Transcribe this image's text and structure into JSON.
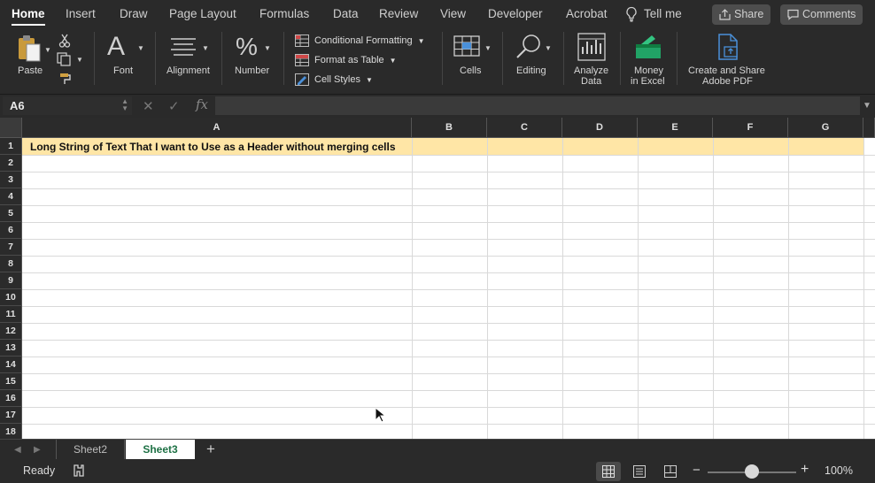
{
  "ribbon_tabs": [
    {
      "label": "Home",
      "active": true
    },
    {
      "label": "Insert",
      "active": false
    },
    {
      "label": "Draw",
      "active": false
    },
    {
      "label": "Page Layout",
      "active": false
    },
    {
      "label": "Formulas",
      "active": false
    },
    {
      "label": "Data",
      "active": false
    },
    {
      "label": "Review",
      "active": false
    },
    {
      "label": "View",
      "active": false
    },
    {
      "label": "Developer",
      "active": false
    },
    {
      "label": "Acrobat",
      "active": false
    }
  ],
  "tell_me": {
    "label": "Tell me",
    "icon": "lightbulb-icon"
  },
  "header_buttons": {
    "share": "Share",
    "comments": "Comments"
  },
  "ribbon": {
    "paste": "Paste",
    "font": "Font",
    "alignment": "Alignment",
    "number": "Number",
    "conditional_formatting": "Conditional Formatting",
    "format_as_table": "Format as Table",
    "cell_styles": "Cell Styles",
    "cells": "Cells",
    "editing": "Editing",
    "analyze_data": [
      "Analyze",
      "Data"
    ],
    "money_in_excel": [
      "Money",
      "in Excel"
    ],
    "create_share_pdf": [
      "Create and Share",
      "Adobe PDF"
    ]
  },
  "formula_bar": {
    "name_box": "A6",
    "fx_label": "fx",
    "formula": ""
  },
  "grid": {
    "columns": [
      "A",
      "B",
      "C",
      "D",
      "E",
      "F",
      "G"
    ],
    "rows": [
      "1",
      "2",
      "3",
      "4",
      "5",
      "6",
      "7",
      "8",
      "9",
      "10",
      "11",
      "12",
      "13",
      "14",
      "15",
      "16",
      "17",
      "18"
    ],
    "cells": {
      "A1": "Long String of Text That I want to Use as a Header without merging cells"
    },
    "row1_fill_color": "#ffe6a6"
  },
  "sheets": [
    {
      "name": "Sheet2",
      "active": false
    },
    {
      "name": "Sheet3",
      "active": true
    }
  ],
  "status": {
    "mode": "Ready",
    "zoom": "100%",
    "zoom_level": 0.5
  },
  "colors": {
    "accent_green": "#1e7145",
    "ribbon_bg": "#2a2a2a"
  }
}
